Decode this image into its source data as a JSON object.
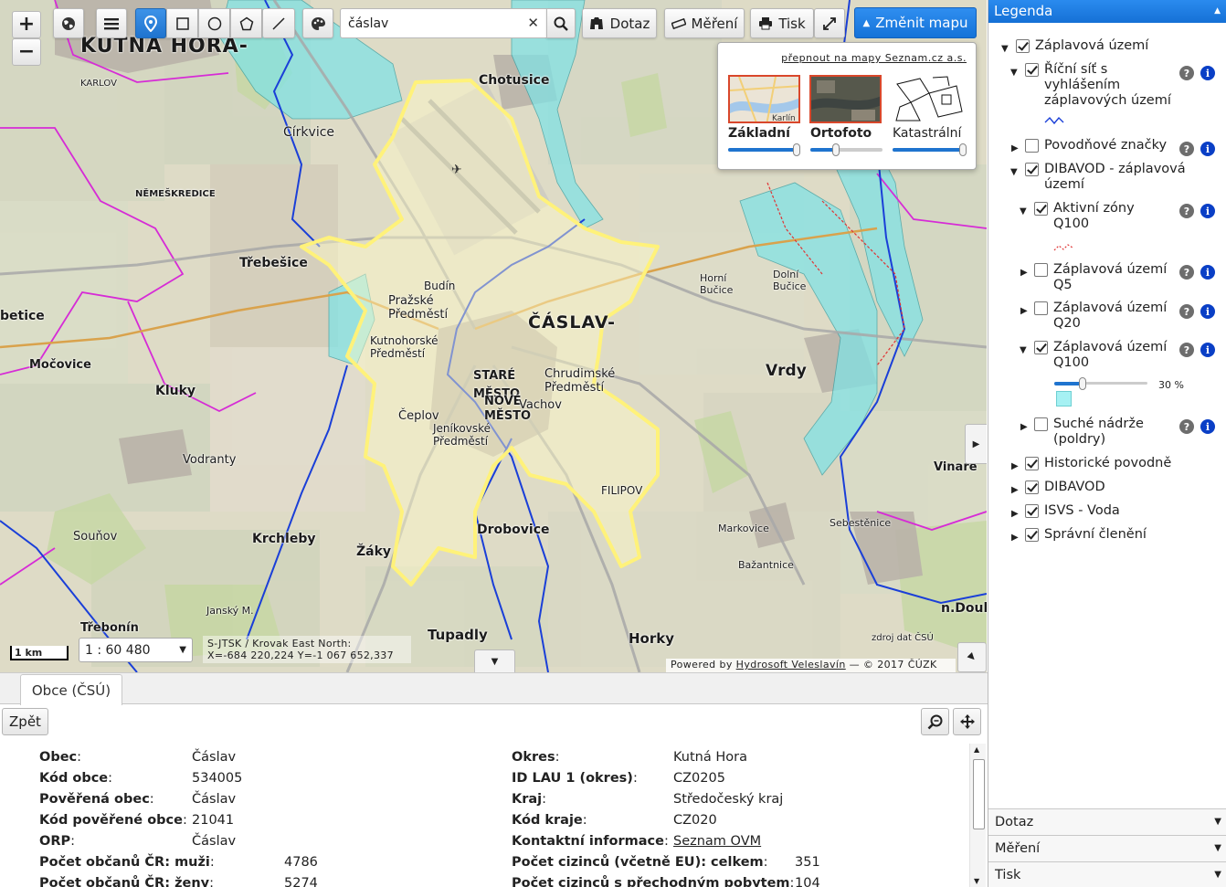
{
  "toolbar": {
    "zoom_in": "+",
    "zoom_out": "−",
    "query_label": "Dotaz",
    "measure_label": "Měření",
    "print_label": "Tisk",
    "change_map_label": "Změnit mapu"
  },
  "search": {
    "value": "čáslav",
    "clear": "✕"
  },
  "map_switcher": {
    "link": "přepnout na mapy Seznam.cz a.s.",
    "options": [
      {
        "label": "Základní",
        "opacity": 0.95,
        "thumb_text": "Karlín"
      },
      {
        "label": "Ortofoto",
        "opacity": 0.35
      },
      {
        "label": "Katastrální",
        "opacity": 0.97
      }
    ]
  },
  "map_labels": {
    "kutna_hora": "KUTNÁ HORA-",
    "karlov": "KARLOV",
    "sirkvice": "Církvice",
    "chotusice": "Chotusice",
    "nemeskredice": "NĚMEŠKREDICE",
    "trebesice": "Třebešice",
    "caslav": "ČÁSLAV-",
    "prazske": "Pražské Předměstí",
    "kutnohorske": "Kutnohorské Předměstí",
    "stare_mesto": "STARÉ MĚSTO",
    "nove_mesto": "NOVÉ MĚSTO",
    "chrudimske": "Chrudimské Předměstí",
    "jenikovske": "Jeníkovské Předměstí",
    "vrdy": "Vrdy",
    "horni_bucice": "Horní Bučice",
    "dolni_bucice": "Dolní Bučice",
    "mocovice": "Močovice",
    "kluky": "Kluky",
    "vodranty": "Vodranty",
    "krchleby": "Krchleby",
    "zaky": "Žáky",
    "tupadly": "Tupadly",
    "horky": "Horky",
    "drobovice": "Drobovice",
    "filipov": "FILIPOV",
    "souhov": "Souňov",
    "vinare": "Vinaře",
    "trebonin": "Třebonín",
    "n_doubrava": "n.Doubra",
    "budin": "Budín",
    "betice": "betice",
    "cepoy": "Čeplov",
    "vachov": "Vachov",
    "jansky": "Janský M.",
    "bazantnice": "Bažantnice",
    "sebestenice": "Sebestěnice",
    "markovice": "Markovice"
  },
  "scale": {
    "bar_label": "1 km",
    "ratio": "1 : 60 480"
  },
  "coordinates": {
    "system": "S-JTSK / Krovak East North:",
    "values": "X=-684 220,224 Y=-1 067 652,337"
  },
  "attribution": {
    "prefix": "Powered by",
    "brand": "Hydrosoft Veleslavín",
    "suffix": "— © 2017 ČÚZK",
    "source_note": "zdroj dat ČSÚ"
  },
  "bottom_panel": {
    "tab": "Obce (ČSÚ)",
    "back": "Zpět",
    "left_rows": [
      {
        "key": "Obec",
        "value": "Čáslav"
      },
      {
        "key": "Kód obce",
        "value": "534005"
      },
      {
        "key": "Pověřená obec",
        "value": "Čáslav"
      },
      {
        "key": "Kód pověřené obce",
        "value": "21041"
      },
      {
        "key": "ORP",
        "value": "Čáslav"
      },
      {
        "key": "Počet občanů ČR: muži",
        "value": "4786"
      },
      {
        "key": "Počet občanů ČR: ženy",
        "value": "5274"
      }
    ],
    "right_rows": [
      {
        "key": "Okres",
        "value": "Kutná Hora"
      },
      {
        "key": "ID LAU 1 (okres)",
        "value": "CZ0205"
      },
      {
        "key": "Kraj",
        "value": "Středočeský kraj"
      },
      {
        "key": "Kód kraje",
        "value": "CZ020"
      },
      {
        "key": "Kontaktní informace",
        "value": "Seznam OVM"
      },
      {
        "key": "Počet cizinců (včetně EU): celkem",
        "value": "351"
      },
      {
        "key": "Počet cizinců s přechodným pobytem",
        "value": "104"
      }
    ]
  },
  "legend": {
    "title": "Legenda",
    "items": [
      {
        "label": "Záplavová území",
        "checked": true
      },
      {
        "label": "Říční síť s vyhlášením záplavových území",
        "checked": true
      },
      {
        "label": "Povodňové značky",
        "checked": false
      },
      {
        "label": "DIBAVOD - záplavová území",
        "checked": true
      },
      {
        "label": "Aktivní zóny Q100",
        "checked": true
      },
      {
        "label": "Záplavová území Q5",
        "checked": false
      },
      {
        "label": "Záplavová území Q20",
        "checked": false
      },
      {
        "label": "Záplavová území Q100",
        "checked": true
      },
      {
        "label": "Suché nádrže (poldry)",
        "checked": false
      },
      {
        "label": "Historické povodně",
        "checked": true
      },
      {
        "label": "DIBAVOD",
        "checked": true
      },
      {
        "label": "ISVS - Voda",
        "checked": true
      },
      {
        "label": "Správní členění",
        "checked": true
      }
    ],
    "q100_opacity": "30 %",
    "q100_opacity_value": 0.3
  },
  "accordion": [
    "Dotaz",
    "Měření",
    "Tisk"
  ],
  "colors": {
    "accent": "#1f74cf",
    "flood": "#7fe3e6",
    "boundary": "#fff27a",
    "border_magenta": "#d62bd6",
    "river": "#1a3fd8"
  }
}
